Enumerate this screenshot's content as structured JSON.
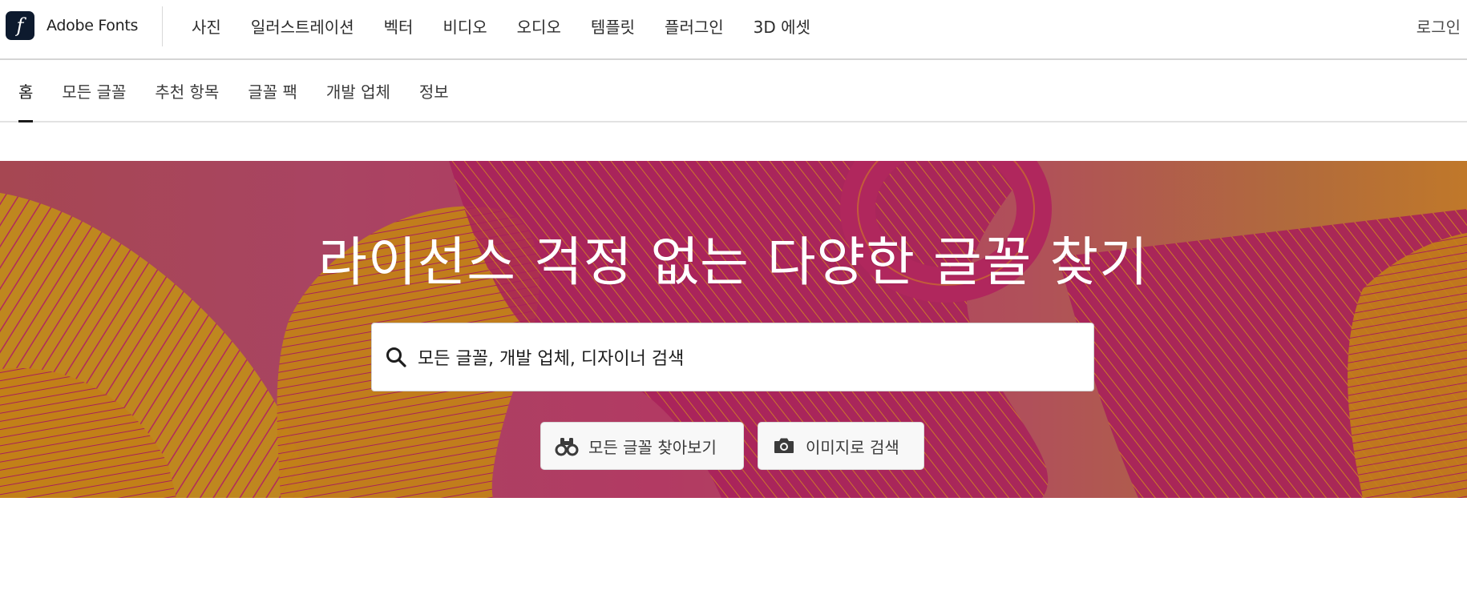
{
  "brand": {
    "name": "Adobe Fonts",
    "logo_glyph": "f",
    "logo_bg": "#0d1a2e"
  },
  "primary_nav": {
    "items": [
      {
        "label": "사진"
      },
      {
        "label": "일러스트레이션"
      },
      {
        "label": "벡터"
      },
      {
        "label": "비디오"
      },
      {
        "label": "오디오"
      },
      {
        "label": "템플릿"
      },
      {
        "label": "플러그인"
      },
      {
        "label": "3D 에셋"
      }
    ],
    "signin_label": "로그인"
  },
  "sub_nav": {
    "tabs": [
      {
        "label": "홈",
        "active": true
      },
      {
        "label": "모든 글꼴"
      },
      {
        "label": "추천 항목"
      },
      {
        "label": "글꼴 팩"
      },
      {
        "label": "개발 업체"
      },
      {
        "label": "정보"
      }
    ]
  },
  "hero": {
    "title": "라이선스 걱정 없는 다양한 글꼴 찾기",
    "search": {
      "placeholder": "모든 글꼴, 개발 업체, 디자이너 검색",
      "icon": "search-icon"
    },
    "buttons": {
      "browse": {
        "label": "모든 글꼴 찾아보기",
        "icon": "binoculars-icon"
      },
      "image_search": {
        "label": "이미지로 검색",
        "icon": "camera-icon"
      }
    },
    "colors": {
      "magenta": "#a8205a",
      "gold": "#c08a1c",
      "line_orange": "#d07f24"
    }
  }
}
